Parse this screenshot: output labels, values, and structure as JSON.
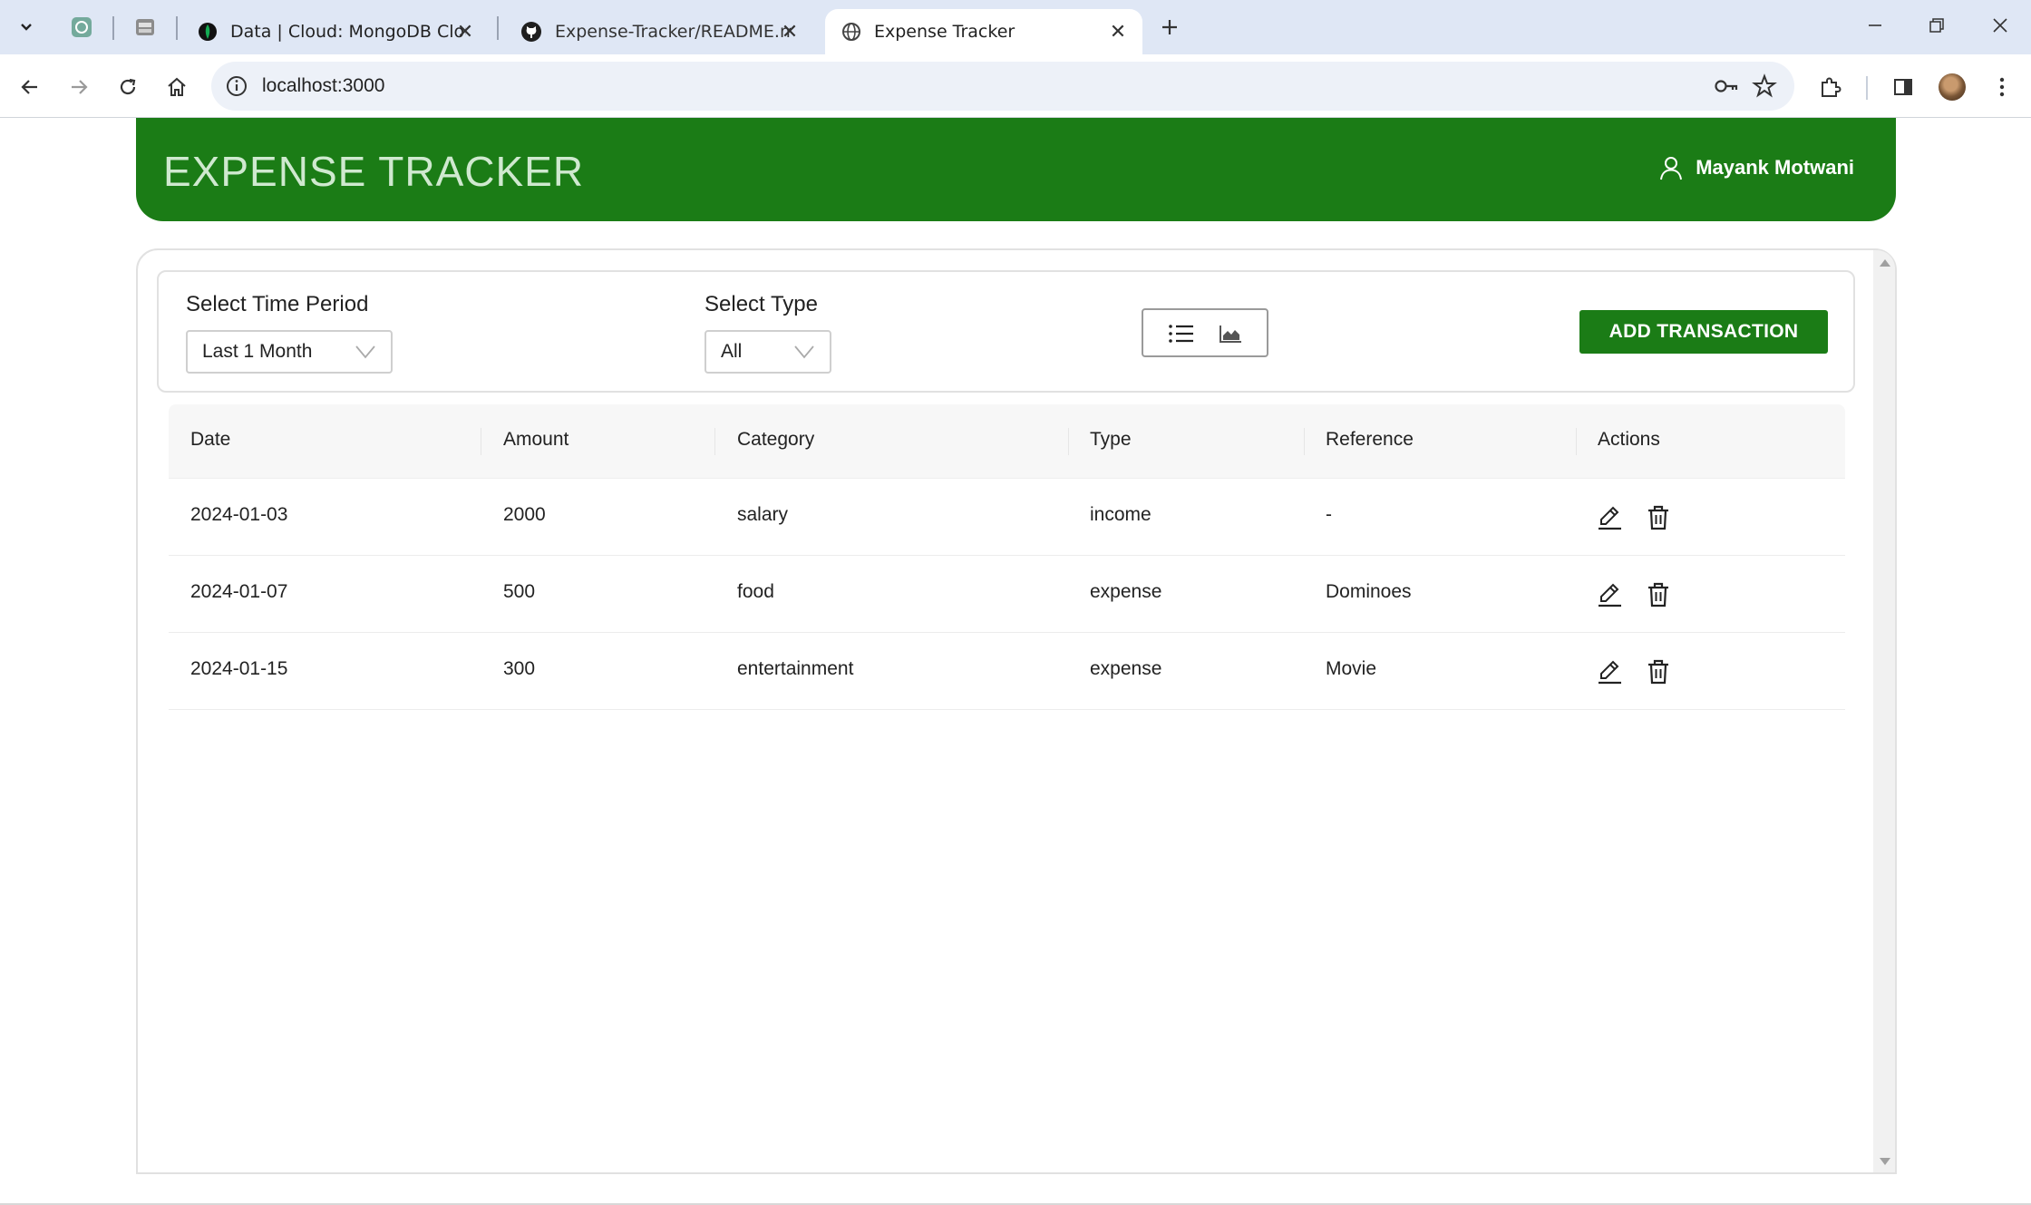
{
  "browser": {
    "tabs": [
      {
        "title": "Data | Cloud: MongoDB Cloud",
        "active": false
      },
      {
        "title": "Expense-Tracker/README.md a",
        "active": false
      },
      {
        "title": "Expense Tracker",
        "active": true
      }
    ],
    "url": "localhost:3000"
  },
  "app": {
    "title": "EXPENSE TRACKER",
    "user_name": "Mayank Motwani",
    "brand_color": "#1b7c16"
  },
  "filters": {
    "time_period_label": "Select Time Period",
    "time_period_value": "Last 1 Month",
    "type_label": "Select Type",
    "type_value": "All",
    "add_button": "ADD TRANSACTION"
  },
  "table": {
    "columns": [
      "Date",
      "Amount",
      "Category",
      "Type",
      "Reference",
      "Actions"
    ],
    "rows": [
      {
        "date": "2024-01-03",
        "amount": "2000",
        "category": "salary",
        "type": "income",
        "reference": "-"
      },
      {
        "date": "2024-01-07",
        "amount": "500",
        "category": "food",
        "type": "expense",
        "reference": "Dominoes"
      },
      {
        "date": "2024-01-15",
        "amount": "300",
        "category": "entertainment",
        "type": "expense",
        "reference": "Movie"
      }
    ]
  }
}
